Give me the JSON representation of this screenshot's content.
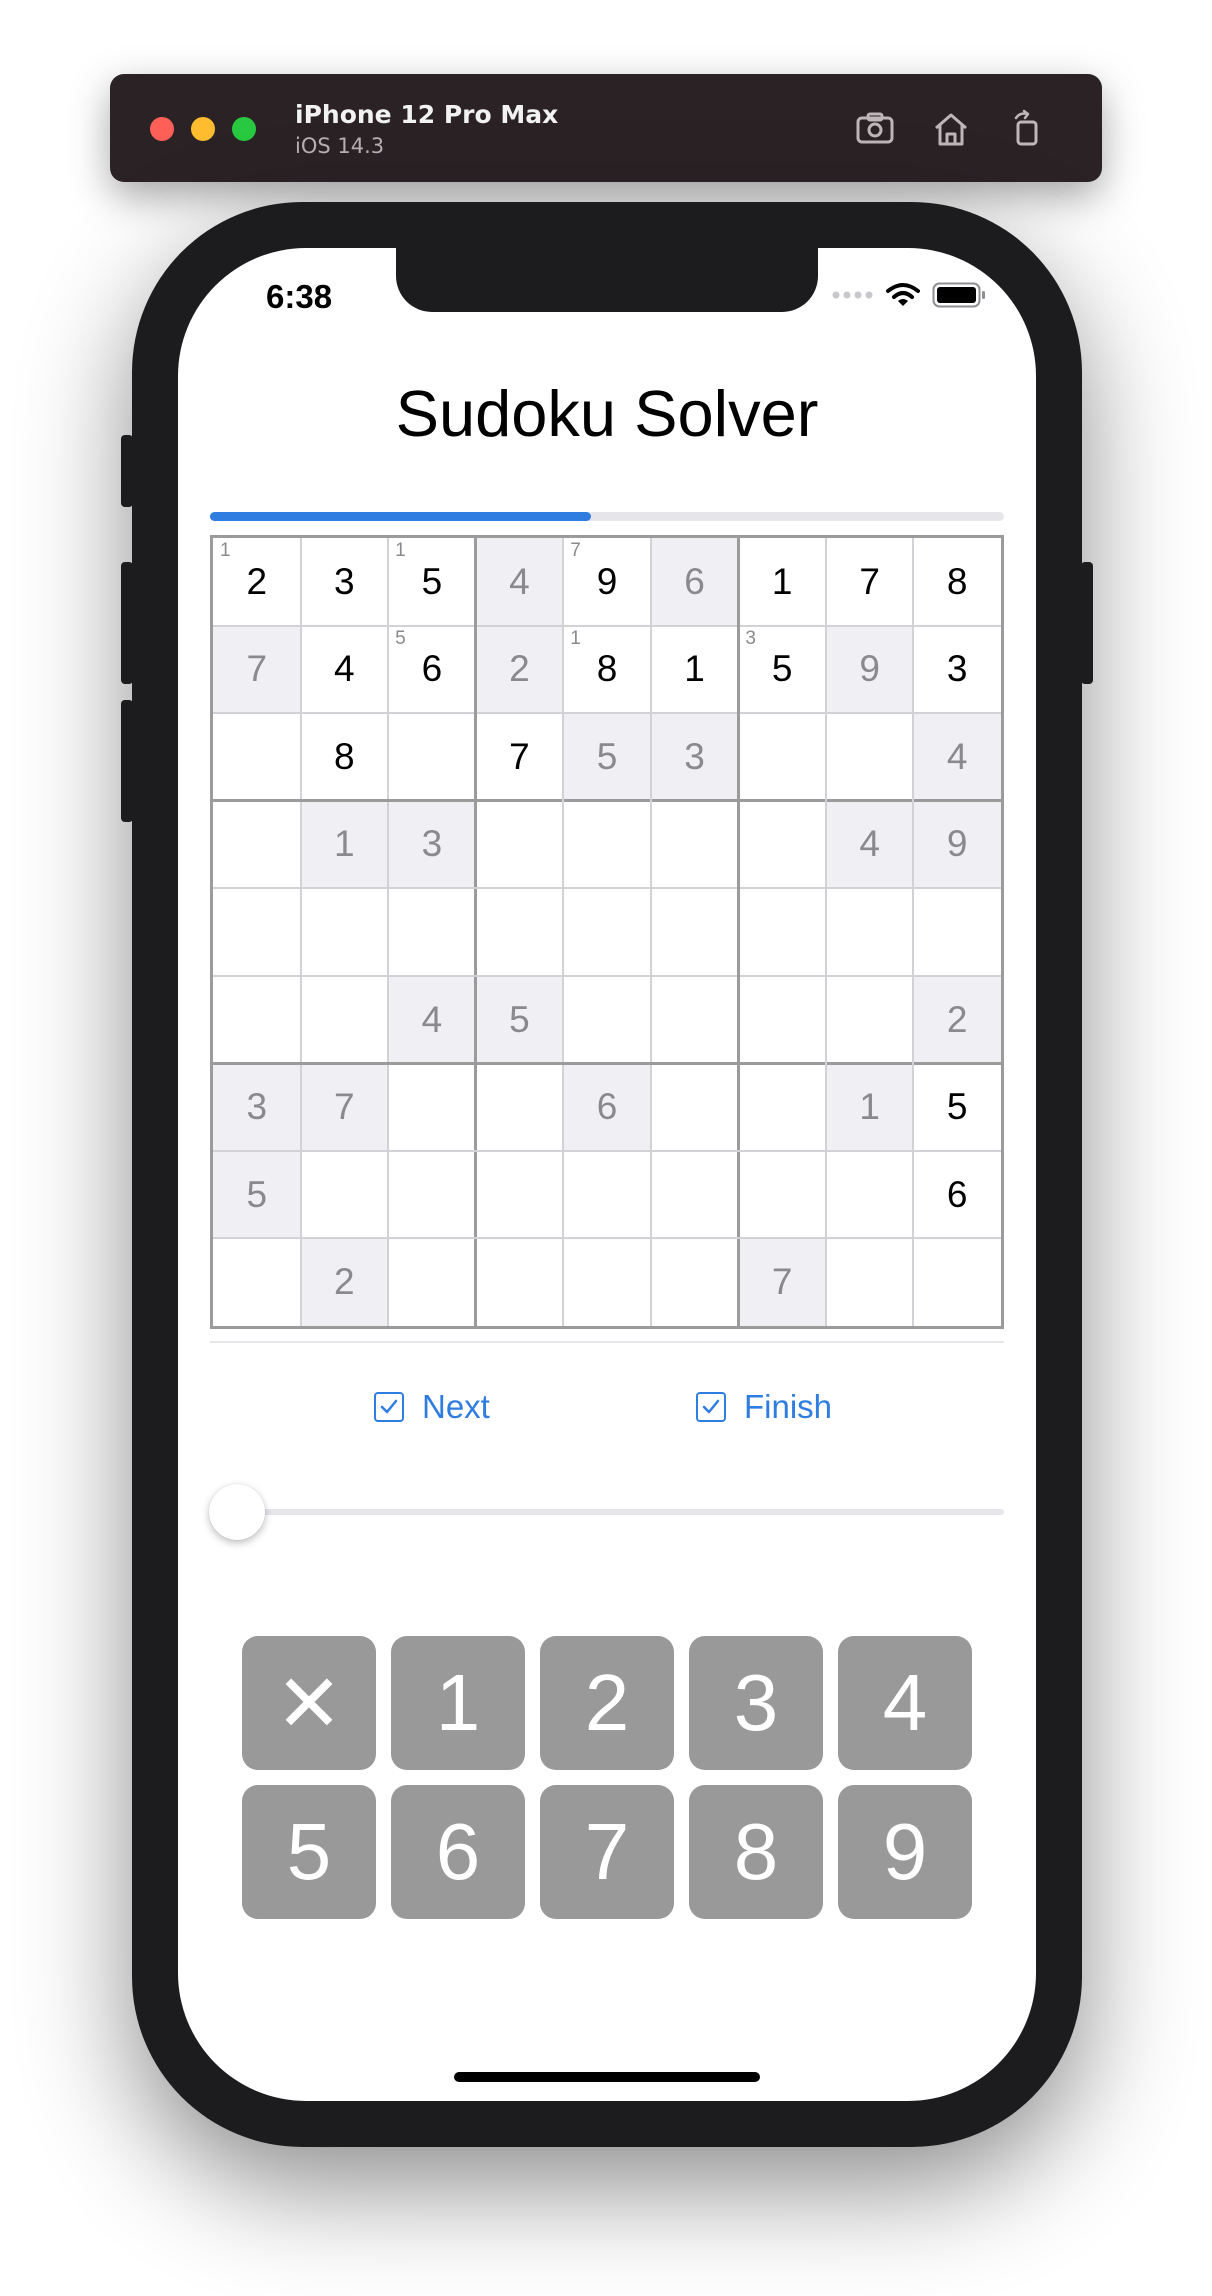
{
  "simulator": {
    "device_name": "iPhone 12 Pro Max",
    "os_version": "iOS 14.3",
    "buttons": [
      "screenshot-icon",
      "home-icon",
      "rotate-icon"
    ]
  },
  "status_bar": {
    "time": "6:38",
    "icons": [
      "signal-dots-icon",
      "wifi-icon",
      "battery-icon"
    ]
  },
  "app": {
    "title": "Sudoku Solver",
    "progress": 0.48,
    "colors": {
      "accent": "#2f7de1",
      "hint_bg": "#efeff4",
      "hint_text": "#8a8a8e",
      "key_bg": "#999999"
    }
  },
  "grid": {
    "rows": [
      [
        {
          "v": "2",
          "t": "given",
          "n": "1"
        },
        {
          "v": "3",
          "t": "given"
        },
        {
          "v": "5",
          "t": "given",
          "n": "1"
        },
        {
          "v": "4",
          "t": "hint"
        },
        {
          "v": "9",
          "t": "given",
          "n": "7"
        },
        {
          "v": "6",
          "t": "hint"
        },
        {
          "v": "1",
          "t": "given"
        },
        {
          "v": "7",
          "t": "given"
        },
        {
          "v": "8",
          "t": "given"
        }
      ],
      [
        {
          "v": "7",
          "t": "hint"
        },
        {
          "v": "4",
          "t": "given"
        },
        {
          "v": "6",
          "t": "given",
          "n": "5"
        },
        {
          "v": "2",
          "t": "hint"
        },
        {
          "v": "8",
          "t": "given",
          "n": "1"
        },
        {
          "v": "1",
          "t": "given"
        },
        {
          "v": "5",
          "t": "given",
          "n": "3"
        },
        {
          "v": "9",
          "t": "hint"
        },
        {
          "v": "3",
          "t": "given"
        }
      ],
      [
        {
          "v": "",
          "t": "empty"
        },
        {
          "v": "8",
          "t": "given"
        },
        {
          "v": "",
          "t": "empty"
        },
        {
          "v": "7",
          "t": "given"
        },
        {
          "v": "5",
          "t": "hint"
        },
        {
          "v": "3",
          "t": "hint"
        },
        {
          "v": "",
          "t": "empty"
        },
        {
          "v": "",
          "t": "empty"
        },
        {
          "v": "4",
          "t": "hint"
        }
      ],
      [
        {
          "v": "",
          "t": "empty"
        },
        {
          "v": "1",
          "t": "hint"
        },
        {
          "v": "3",
          "t": "hint"
        },
        {
          "v": "",
          "t": "empty"
        },
        {
          "v": "",
          "t": "empty"
        },
        {
          "v": "",
          "t": "empty"
        },
        {
          "v": "",
          "t": "empty"
        },
        {
          "v": "4",
          "t": "hint"
        },
        {
          "v": "9",
          "t": "hint"
        }
      ],
      [
        {
          "v": "",
          "t": "empty"
        },
        {
          "v": "",
          "t": "empty"
        },
        {
          "v": "",
          "t": "empty"
        },
        {
          "v": "",
          "t": "empty"
        },
        {
          "v": "",
          "t": "empty"
        },
        {
          "v": "",
          "t": "empty"
        },
        {
          "v": "",
          "t": "empty"
        },
        {
          "v": "",
          "t": "empty"
        },
        {
          "v": "",
          "t": "empty"
        }
      ],
      [
        {
          "v": "",
          "t": "empty"
        },
        {
          "v": "",
          "t": "empty"
        },
        {
          "v": "4",
          "t": "hint"
        },
        {
          "v": "5",
          "t": "hint"
        },
        {
          "v": "",
          "t": "empty"
        },
        {
          "v": "",
          "t": "empty"
        },
        {
          "v": "",
          "t": "empty"
        },
        {
          "v": "",
          "t": "empty"
        },
        {
          "v": "2",
          "t": "hint"
        }
      ],
      [
        {
          "v": "3",
          "t": "hint"
        },
        {
          "v": "7",
          "t": "hint"
        },
        {
          "v": "",
          "t": "empty"
        },
        {
          "v": "",
          "t": "empty"
        },
        {
          "v": "6",
          "t": "hint"
        },
        {
          "v": "",
          "t": "empty"
        },
        {
          "v": "",
          "t": "empty"
        },
        {
          "v": "1",
          "t": "hint"
        },
        {
          "v": "5",
          "t": "given"
        }
      ],
      [
        {
          "v": "5",
          "t": "hint"
        },
        {
          "v": "",
          "t": "empty"
        },
        {
          "v": "",
          "t": "empty"
        },
        {
          "v": "",
          "t": "empty"
        },
        {
          "v": "",
          "t": "empty"
        },
        {
          "v": "",
          "t": "empty"
        },
        {
          "v": "",
          "t": "empty"
        },
        {
          "v": "",
          "t": "empty"
        },
        {
          "v": "6",
          "t": "given"
        }
      ],
      [
        {
          "v": "",
          "t": "empty"
        },
        {
          "v": "2",
          "t": "hint"
        },
        {
          "v": "",
          "t": "empty"
        },
        {
          "v": "",
          "t": "empty"
        },
        {
          "v": "",
          "t": "empty"
        },
        {
          "v": "",
          "t": "empty"
        },
        {
          "v": "7",
          "t": "hint"
        },
        {
          "v": "",
          "t": "empty"
        },
        {
          "v": ""
        }
      ]
    ]
  },
  "controls": {
    "next_label": "Next",
    "finish_label": "Finish",
    "next_checked": true,
    "finish_checked": true,
    "slider_value": 0
  },
  "keypad": {
    "keys": [
      "✕",
      "1",
      "2",
      "3",
      "4",
      "5",
      "6",
      "7",
      "8",
      "9"
    ]
  }
}
